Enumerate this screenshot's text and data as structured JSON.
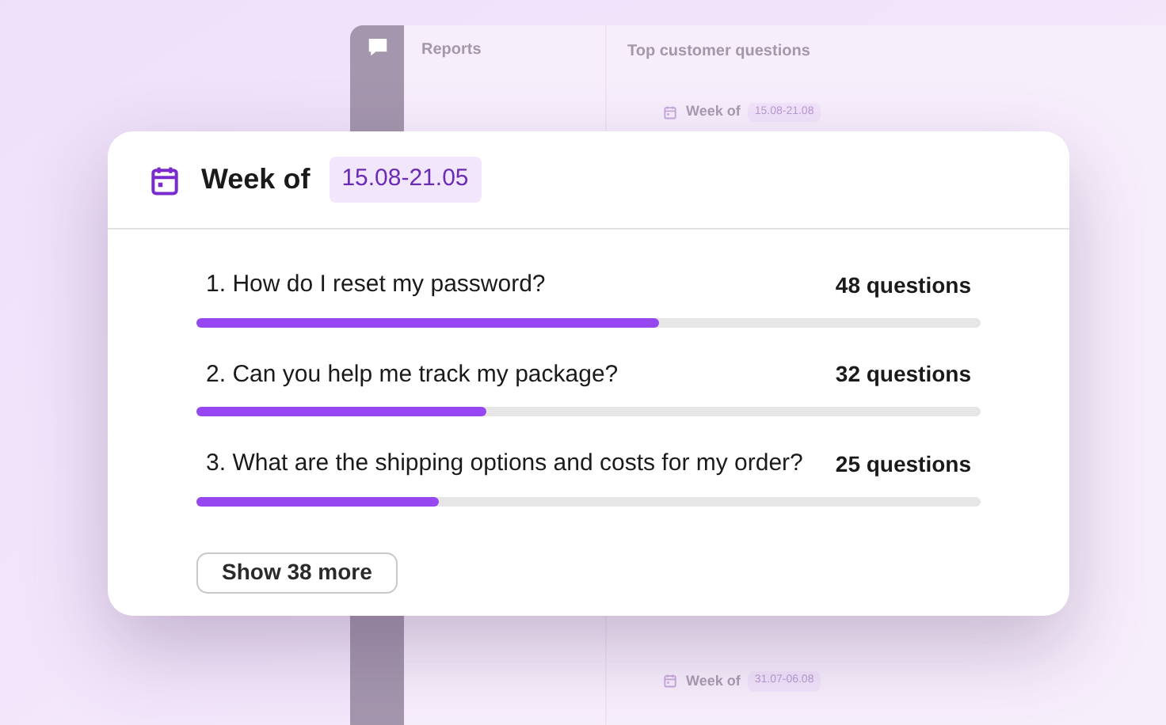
{
  "background_app": {
    "sidebar_title": "Reports",
    "main_title": "Top customer questions",
    "weeks": [
      {
        "label": "Week of",
        "range": "15.08-21.08"
      },
      {
        "label": "Week of",
        "range": "31.07-06.08"
      }
    ]
  },
  "card": {
    "title": "Week of",
    "range": "15.08-21.05",
    "questions": [
      {
        "number": "1.",
        "text": "How do I reset my password?",
        "count": "48 questions",
        "level": 0.59
      },
      {
        "number": "2.",
        "text": "Can you help me track my package?",
        "count": "32 questions",
        "level": 0.37
      },
      {
        "number": "3.",
        "text": "What are the shipping options and costs for my order?",
        "count": "25 questions",
        "level": 0.31
      }
    ],
    "more_button": "Show 38 more"
  }
}
